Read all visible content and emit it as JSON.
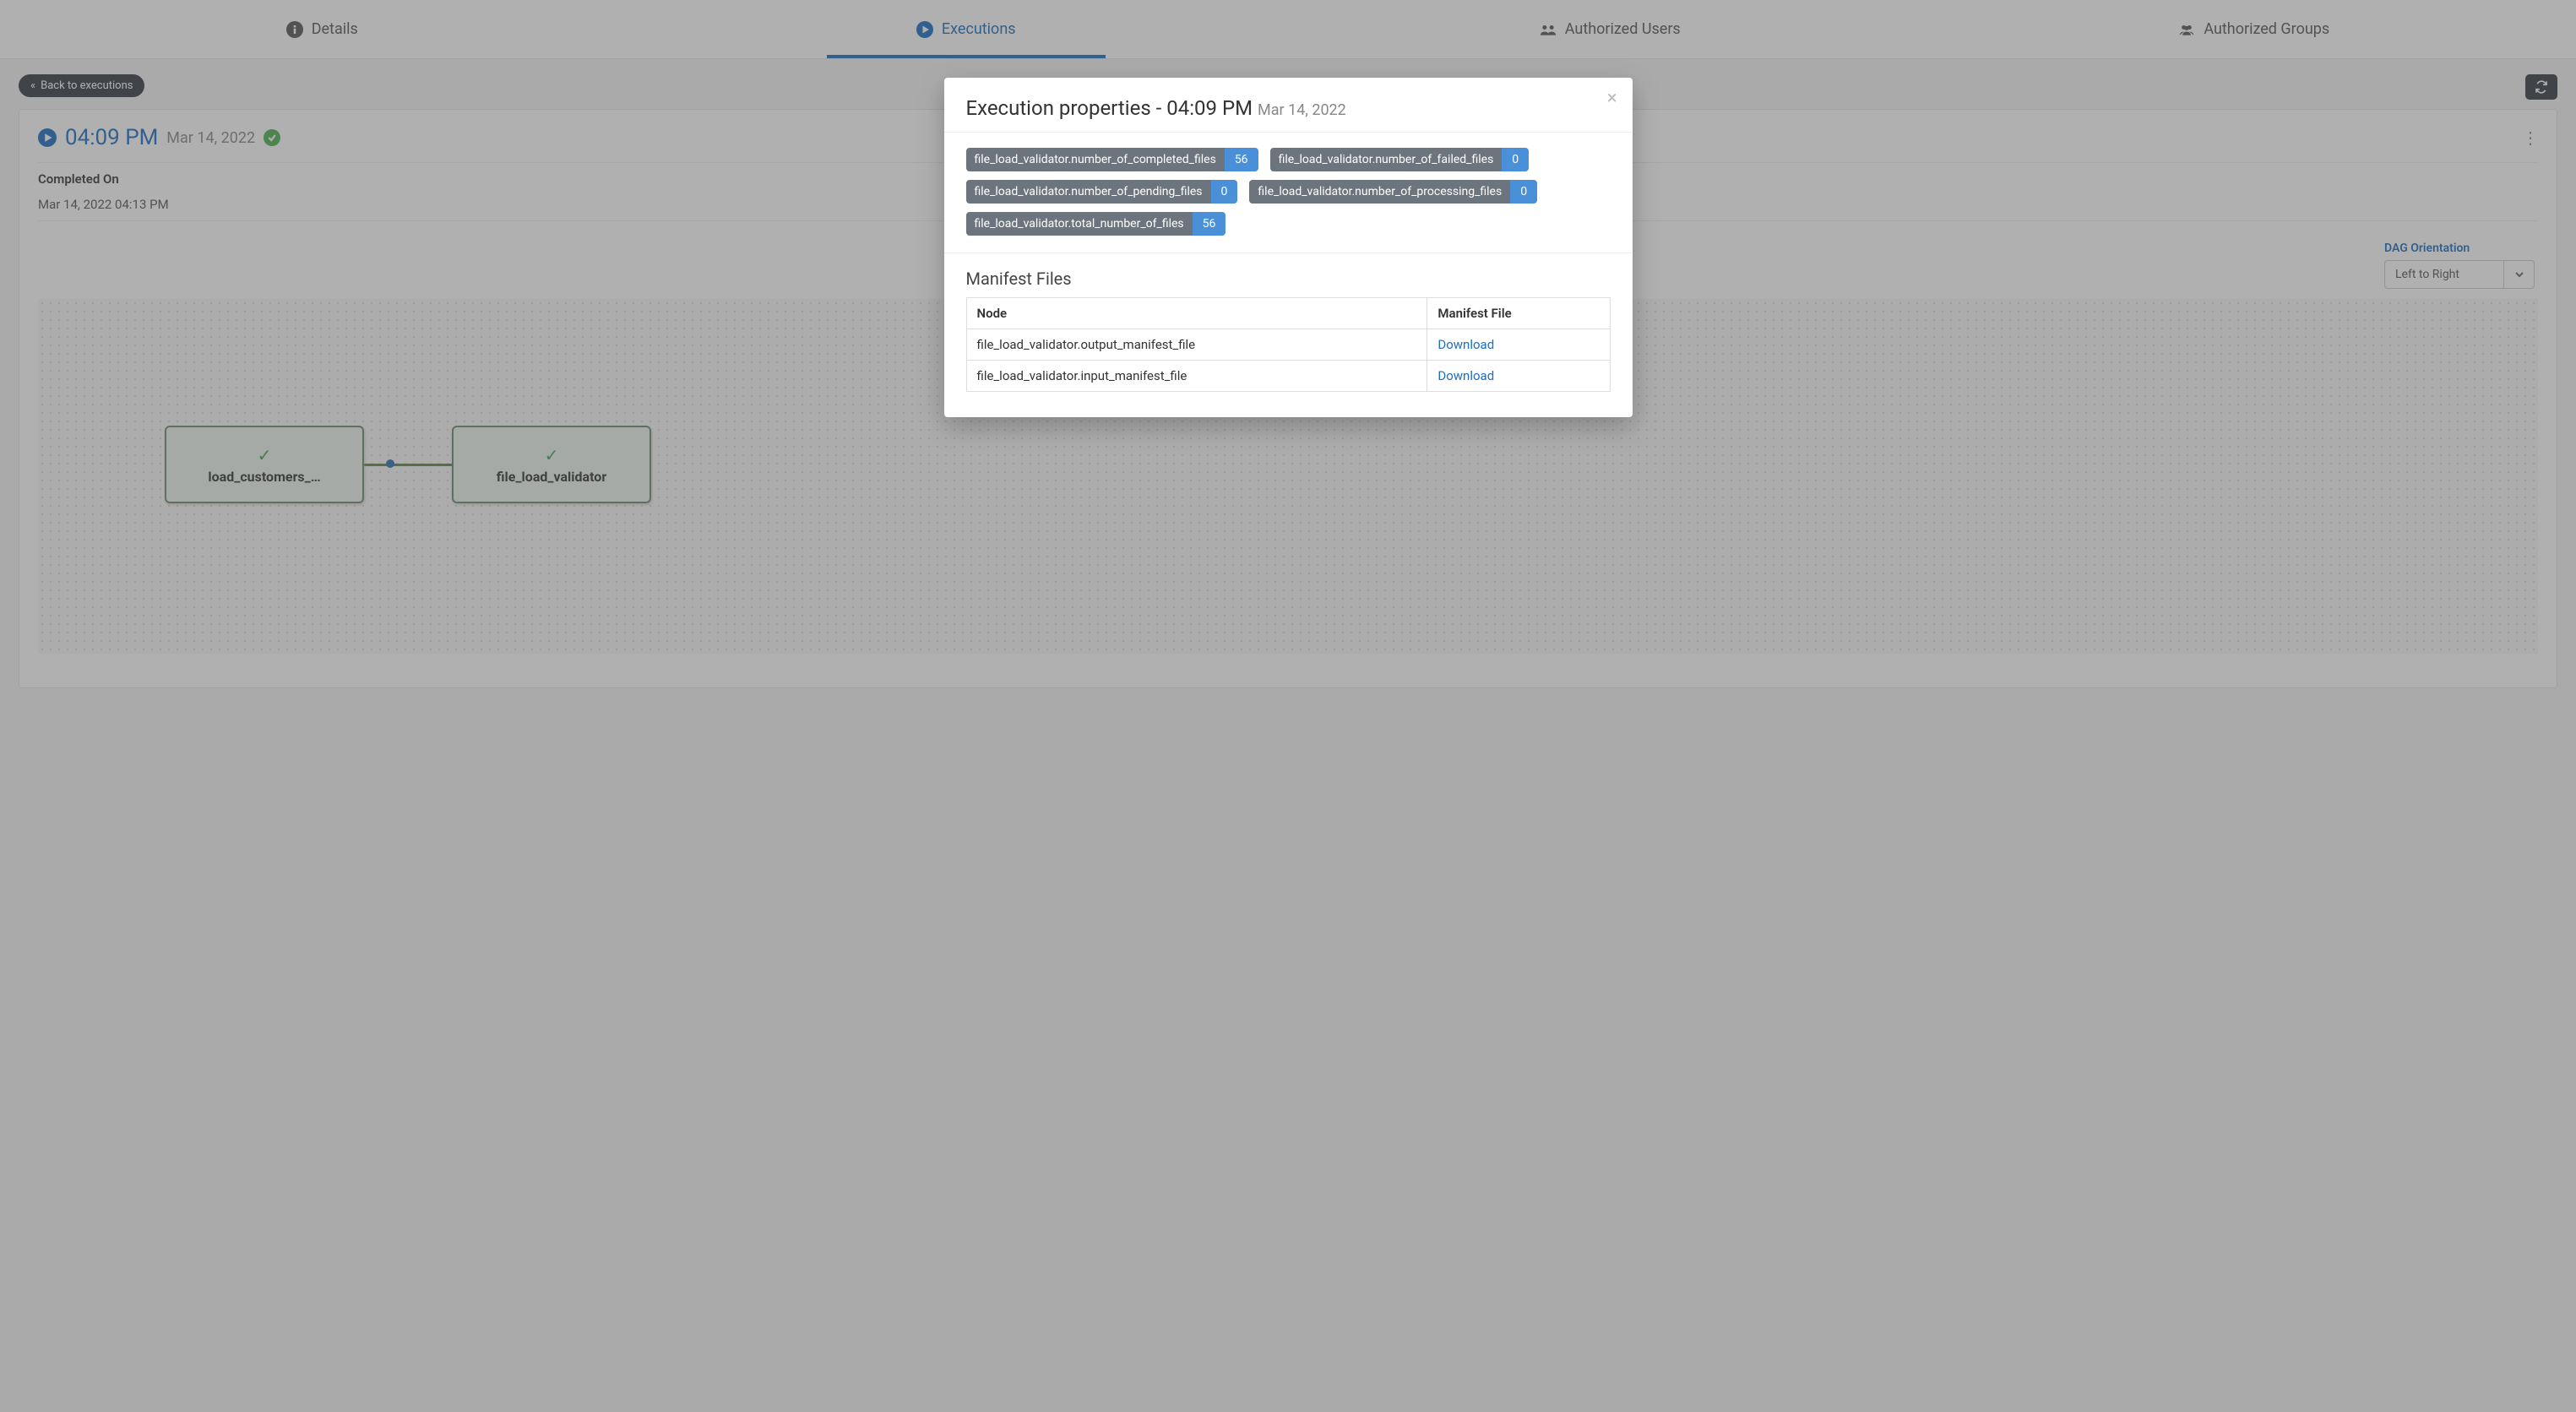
{
  "tabs": {
    "details": "Details",
    "executions": "Executions",
    "authorized_users": "Authorized Users",
    "authorized_groups": "Authorized Groups"
  },
  "back_label": "Back to executions",
  "execution": {
    "time": "04:09 PM",
    "date": "Mar 14, 2022",
    "completed_on_label": "Completed On",
    "completed_on_value": "Mar 14, 2022 04:13 PM"
  },
  "dag": {
    "orientation_label": "DAG Orientation",
    "orientation_value": "Left to Right",
    "node1": "load_customers_…",
    "node2": "file_load_validator"
  },
  "modal": {
    "title_prefix": "Execution properties - ",
    "title_time": "04:09 PM",
    "title_date": "Mar 14, 2022",
    "properties": [
      {
        "key": "file_load_validator.number_of_completed_files",
        "value": "56"
      },
      {
        "key": "file_load_validator.number_of_failed_files",
        "value": "0"
      },
      {
        "key": "file_load_validator.number_of_pending_files",
        "value": "0"
      },
      {
        "key": "file_load_validator.number_of_processing_files",
        "value": "0"
      },
      {
        "key": "file_load_validator.total_number_of_files",
        "value": "56"
      }
    ],
    "manifest_heading": "Manifest Files",
    "col_node": "Node",
    "col_file": "Manifest File",
    "rows": [
      {
        "node": "file_load_validator.output_manifest_file",
        "link": "Download"
      },
      {
        "node": "file_load_validator.input_manifest_file",
        "link": "Download"
      }
    ]
  }
}
